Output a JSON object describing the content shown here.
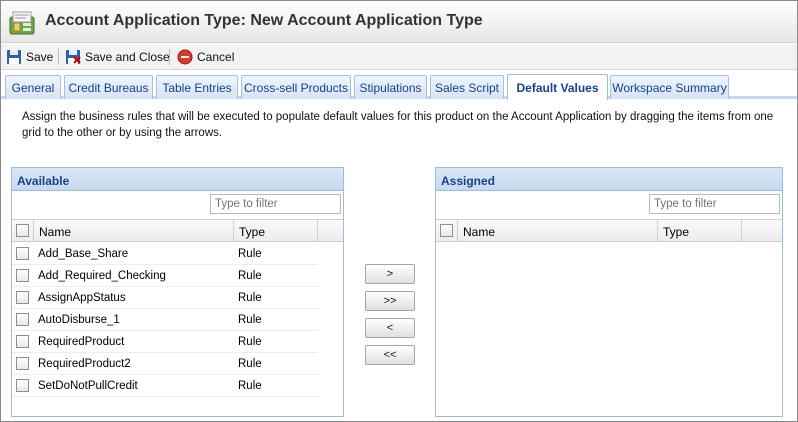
{
  "window": {
    "title": "Account Application Type: New Account Application Type"
  },
  "toolbar": {
    "save": "Save",
    "save_close": "Save and Close",
    "cancel": "Cancel"
  },
  "tabs": [
    {
      "label": "General",
      "active": false
    },
    {
      "label": "Credit Bureaus",
      "active": false
    },
    {
      "label": "Table Entries",
      "active": false
    },
    {
      "label": "Cross-sell Products",
      "active": false
    },
    {
      "label": "Stipulations",
      "active": false
    },
    {
      "label": "Sales Script",
      "active": false
    },
    {
      "label": "Default Values",
      "active": true
    },
    {
      "label": "Workspace Summary",
      "active": false
    }
  ],
  "description": "Assign the business rules that will be executed to populate default values for this product on the Account Application by dragging the items from one grid to the other or by using the arrows.",
  "available": {
    "title": "Available",
    "filter_placeholder": "Type to filter",
    "columns": {
      "name": "Name",
      "type": "Type"
    },
    "rows": [
      {
        "name": "Add_Base_Share",
        "type": "Rule"
      },
      {
        "name": "Add_Required_Checking",
        "type": "Rule"
      },
      {
        "name": "AssignAppStatus",
        "type": "Rule"
      },
      {
        "name": "AutoDisburse_1",
        "type": "Rule"
      },
      {
        "name": "RequiredProduct",
        "type": "Rule"
      },
      {
        "name": "RequiredProduct2",
        "type": "Rule"
      },
      {
        "name": "SetDoNotPullCredit",
        "type": "Rule"
      }
    ]
  },
  "assigned": {
    "title": "Assigned",
    "filter_placeholder": "Type to filter",
    "columns": {
      "name": "Name",
      "type": "Type"
    },
    "rows": []
  },
  "arrows": {
    "move_right": ">",
    "move_all_right": ">>",
    "move_left": "<",
    "move_all_left": "<<"
  }
}
